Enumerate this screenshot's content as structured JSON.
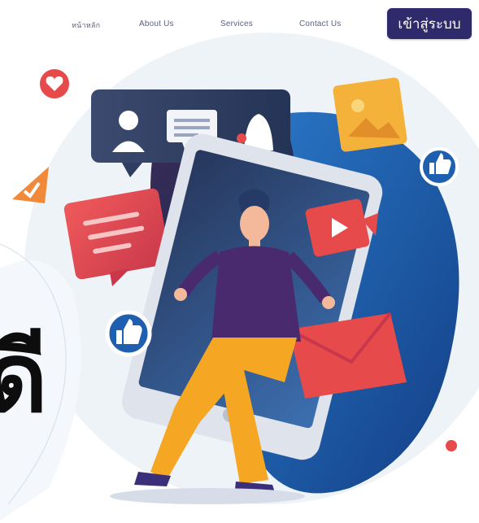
{
  "nav": {
    "home_label": "หน้าหลัก",
    "about_label": "About Us",
    "services_label": "Services",
    "contact_label": "Contact Us",
    "login_label": "เข้าสู่ระบบ"
  },
  "hero": {
    "partial_heading_char": "ดี"
  },
  "colors": {
    "login_button": "#2f2a6b",
    "blob_blue": "#1f5fb0",
    "accent_red": "#e64a4a",
    "accent_yellow": "#f5b23a"
  },
  "icons": [
    "heart-icon",
    "user-icon",
    "chat-icon",
    "bell-icon",
    "image-icon",
    "like-icon",
    "play-icon",
    "mail-icon"
  ]
}
